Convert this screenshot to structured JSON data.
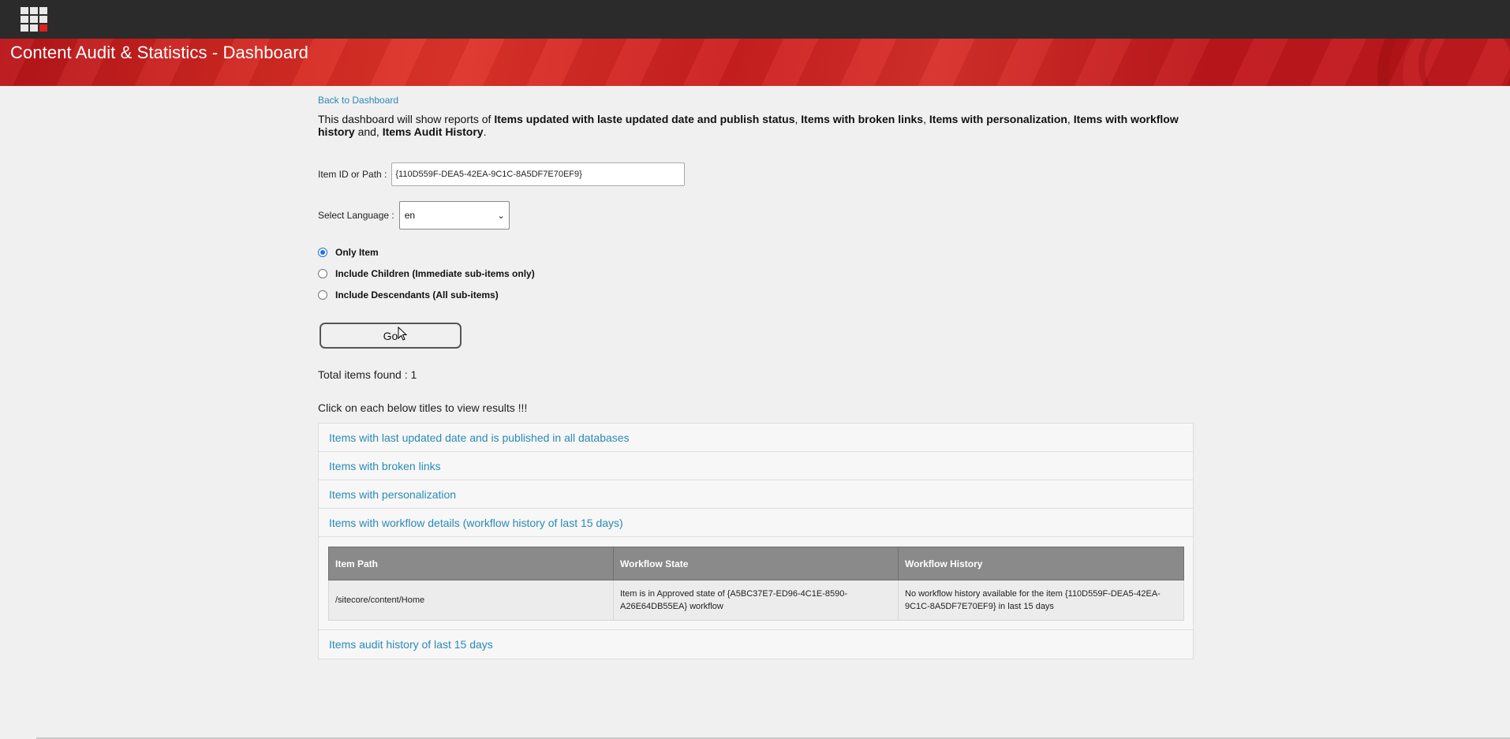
{
  "header": {
    "apps_icon": "apps-grid-icon",
    "title": "Content Audit & Statistics - Dashboard"
  },
  "nav": {
    "back_link": "Back to Dashboard"
  },
  "intro": {
    "p1": "This dashboard will show reports of ",
    "b1": "Items updated with laste updated date and publish status",
    "p2": ", ",
    "b2": "Items with broken links",
    "p3": ", ",
    "b3": "Items with personalization",
    "p4": ", ",
    "b4": "Items with workflow history",
    "p5": " and, ",
    "b5": "Items Audit History",
    "p6": "."
  },
  "form": {
    "item_label": "Item ID or Path :",
    "item_value": "{110D559F-DEA5-42EA-9C1C-8A5DF7E70EF9}",
    "lang_label": "Select Language :",
    "lang_value": "en",
    "options": [
      {
        "label": "Only Item",
        "checked": true
      },
      {
        "label": "Include Children (Immediate sub-items only)",
        "checked": false
      },
      {
        "label": "Include Descendants (All sub-items)",
        "checked": false
      }
    ],
    "go_label": "Go"
  },
  "results": {
    "total": "Total items found : 1",
    "hint": "Click on each below titles to view results !!!",
    "sections": [
      "Items with last updated date and is published in all databases",
      "Items with broken links",
      "Items with personalization",
      "Items with workflow details (workflow history of last 15 days)",
      "Items audit history of last 15 days"
    ],
    "workflow_table": {
      "headers": [
        "Item Path",
        "Workflow State",
        "Workflow History"
      ],
      "rows": [
        [
          "/sitecore/content/Home",
          "Item is in Approved state of {A5BC37E7-ED96-4C1E-8590-A26E64DB55EA} workflow",
          "No workflow history available for the item {110D559F-DEA5-42EA-9C1C-8A5DF7E70EF9} in last 15 days"
        ]
      ]
    }
  },
  "colors": {
    "link": "#2a8ab5",
    "banner_red": "#d42a22",
    "topbar": "#2b2b2b"
  }
}
